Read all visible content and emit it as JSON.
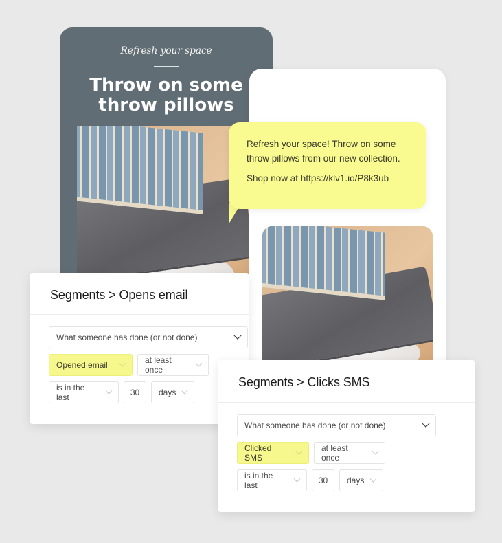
{
  "email": {
    "eyebrow": "Refresh your space",
    "headline_line1": "Throw on some",
    "headline_line2": "throw pillows"
  },
  "sms": {
    "message": "Refresh your space! Throw on some throw pillows from our new collection.",
    "cta": "Shop now at https://klv1.io/P8k3ub"
  },
  "segments": [
    {
      "title": "Segments > Opens email",
      "condition": "What someone has done (or not done)",
      "action": "Opened email",
      "frequency": "at least once",
      "timeframe": "is in the last",
      "amount": "30",
      "unit": "days"
    },
    {
      "title": "Segments > Clicks SMS",
      "condition": "What someone has done (or not done)",
      "action": "Clicked SMS",
      "frequency": "at least once",
      "timeframe": "is in the last",
      "amount": "30",
      "unit": "days"
    }
  ],
  "colors": {
    "background": "#e9e9e9",
    "email_card": "#616d74",
    "highlight_yellow": "#f6f78c",
    "bubble_yellow": "#f9fa8f"
  }
}
